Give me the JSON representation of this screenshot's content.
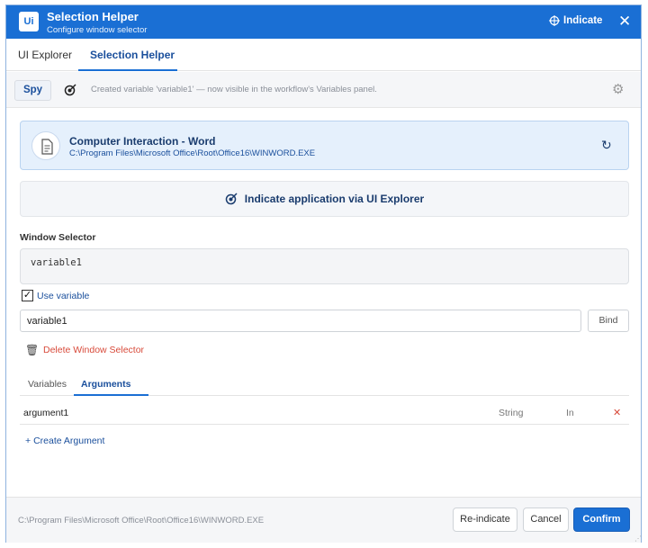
{
  "window": {
    "title": "Selection Helper",
    "subtitle": "Configure window selector",
    "logo": "Ui",
    "indicate_label": "Indicate",
    "close_icon": "close-icon"
  },
  "tabs": [
    {
      "label": "UI Explorer",
      "active": false
    },
    {
      "label": "Selection Helper",
      "active": true
    }
  ],
  "toolbar": {
    "spy_label": "Spy",
    "message": "Created variable 'variable1' — now visible in the workflow's Variables panel."
  },
  "app": {
    "name": "Computer Interaction - Word",
    "path": "C:\\Program Files\\Microsoft Office\\Root\\Office16\\WINWORD.EXE"
  },
  "indicate_app_label": "Indicate application via UI Explorer",
  "window_selector": {
    "label": "Window Selector",
    "value": "variable1",
    "use_variable_label": "Use variable",
    "use_variable_checked": true,
    "variable_input_value": "variable1",
    "bind_label": "Bind",
    "delete_label": "Delete Window Selector"
  },
  "args_tabs": [
    {
      "label": "Variables",
      "active": false
    },
    {
      "label": "Arguments",
      "active": true
    }
  ],
  "arguments": [
    {
      "name": "argument1",
      "type": "String",
      "direction": "In"
    }
  ],
  "create_argument_label": "Create Argument",
  "footer": {
    "path": "C:\\Program Files\\Microsoft Office\\Root\\Office16\\WINWORD.EXE",
    "reindicate_label": "Re-indicate",
    "cancel_label": "Cancel",
    "confirm_label": "Confirm"
  },
  "colors": {
    "accent": "#1a6fd4",
    "danger": "#d84a3a",
    "card_bg": "#e5f0fc"
  }
}
